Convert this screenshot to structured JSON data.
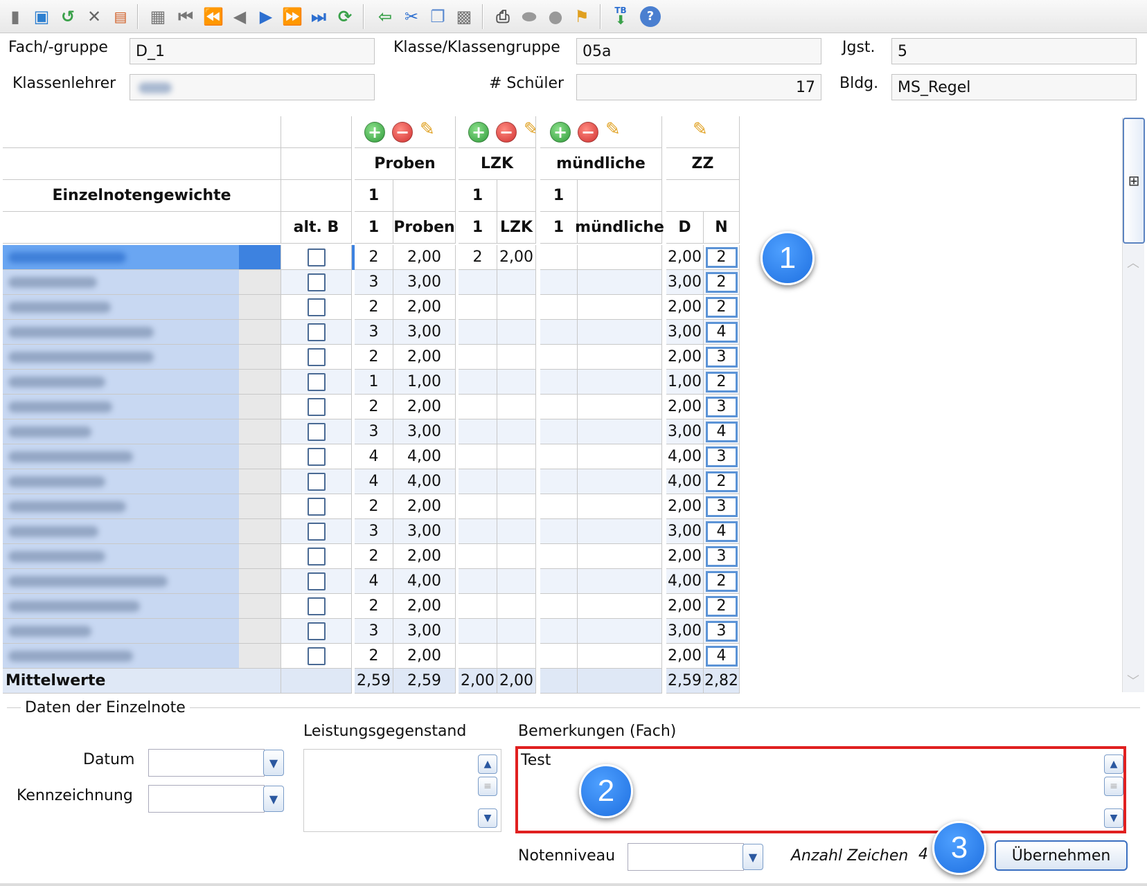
{
  "toolbar": {
    "icons": [
      "new-icon",
      "save-icon",
      "undo-icon",
      "delete-icon",
      "form-icon",
      "copy-record-icon",
      "first-icon",
      "fast-back-icon",
      "prev-icon",
      "next-icon",
      "fast-forward-icon",
      "last-icon",
      "refresh-icon",
      "back-arrow-icon",
      "cut-icon",
      "copy-icon",
      "paste-icon",
      "print-icon",
      "disk-icon",
      "lightbulb-icon",
      "broom-icon",
      "tb-import-icon",
      "help-icon"
    ],
    "tb_text": "TB"
  },
  "header": {
    "fach_label": "Fach/-gruppe",
    "fach_value": "D_1",
    "klasse_label": "Klasse/Klassengruppe",
    "klasse_value": "05a",
    "jgst_label": "Jgst.",
    "jgst_value": "5",
    "lehrer_label": "Klassenlehrer",
    "lehrer_value": "",
    "schueler_label": "# Schüler",
    "schueler_value": "17",
    "bldg_label": "Bldg.",
    "bldg_value": "MS_Regel"
  },
  "grid": {
    "title": "Einzelnotengewichte",
    "alt_b": "alt. B",
    "groups": [
      {
        "name": "Proben",
        "weight": "1",
        "sub_weight": "1",
        "sub_name": "Proben"
      },
      {
        "name": "LZK",
        "weight": "1",
        "sub_weight": "1",
        "sub_name": "LZK"
      },
      {
        "name": "mündliche",
        "weight": "1",
        "sub_weight": "1",
        "sub_name": "mündliche"
      },
      {
        "name": "ZZ",
        "d": "D",
        "n": "N"
      }
    ],
    "rows": [
      {
        "p1": "2",
        "p2": "2,00",
        "l1": "2",
        "l2": "2,00",
        "d": "2,00",
        "n": "2"
      },
      {
        "p1": "3",
        "p2": "3,00",
        "l1": "",
        "l2": "",
        "d": "3,00",
        "n": "2"
      },
      {
        "p1": "2",
        "p2": "2,00",
        "l1": "",
        "l2": "",
        "d": "2,00",
        "n": "2"
      },
      {
        "p1": "3",
        "p2": "3,00",
        "l1": "",
        "l2": "",
        "d": "3,00",
        "n": "4"
      },
      {
        "p1": "2",
        "p2": "2,00",
        "l1": "",
        "l2": "",
        "d": "2,00",
        "n": "3"
      },
      {
        "p1": "1",
        "p2": "1,00",
        "l1": "",
        "l2": "",
        "d": "1,00",
        "n": "2"
      },
      {
        "p1": "2",
        "p2": "2,00",
        "l1": "",
        "l2": "",
        "d": "2,00",
        "n": "3"
      },
      {
        "p1": "3",
        "p2": "3,00",
        "l1": "",
        "l2": "",
        "d": "3,00",
        "n": "4"
      },
      {
        "p1": "4",
        "p2": "4,00",
        "l1": "",
        "l2": "",
        "d": "4,00",
        "n": "3"
      },
      {
        "p1": "4",
        "p2": "4,00",
        "l1": "",
        "l2": "",
        "d": "4,00",
        "n": "2"
      },
      {
        "p1": "2",
        "p2": "2,00",
        "l1": "",
        "l2": "",
        "d": "2,00",
        "n": "3"
      },
      {
        "p1": "3",
        "p2": "3,00",
        "l1": "",
        "l2": "",
        "d": "3,00",
        "n": "4"
      },
      {
        "p1": "2",
        "p2": "2,00",
        "l1": "",
        "l2": "",
        "d": "2,00",
        "n": "3"
      },
      {
        "p1": "4",
        "p2": "4,00",
        "l1": "",
        "l2": "",
        "d": "4,00",
        "n": "2"
      },
      {
        "p1": "2",
        "p2": "2,00",
        "l1": "",
        "l2": "",
        "d": "2,00",
        "n": "2"
      },
      {
        "p1": "3",
        "p2": "3,00",
        "l1": "",
        "l2": "",
        "d": "3,00",
        "n": "3"
      },
      {
        "p1": "2",
        "p2": "2,00",
        "l1": "",
        "l2": "",
        "d": "2,00",
        "n": "4"
      }
    ],
    "footer": {
      "label": "Mittelwerte",
      "p1": "2,59",
      "p2": "2,59",
      "l1": "2,00",
      "l2": "2,00",
      "d": "2,59",
      "n": "2,82"
    }
  },
  "details": {
    "section_title": "Daten der Einzelnote",
    "datum_label": "Datum",
    "kenn_label": "Kennzeichnung",
    "leistung_label": "Leistungsgegenstand",
    "bemerk_label": "Bemerkungen (Fach)",
    "bemerk_value": "Test",
    "noten_label": "Notenniveau",
    "anzahl_label": "Anzahl Zeichen",
    "anzahl_value": "4",
    "uebernehmen": "Übernehmen"
  },
  "badges": [
    "1",
    "2",
    "3"
  ],
  "colors": {
    "selection": "#5a9cf0",
    "highlight_border": "#e02020",
    "badge": "#1e6fe0",
    "row_alt": "#eef3fb"
  }
}
